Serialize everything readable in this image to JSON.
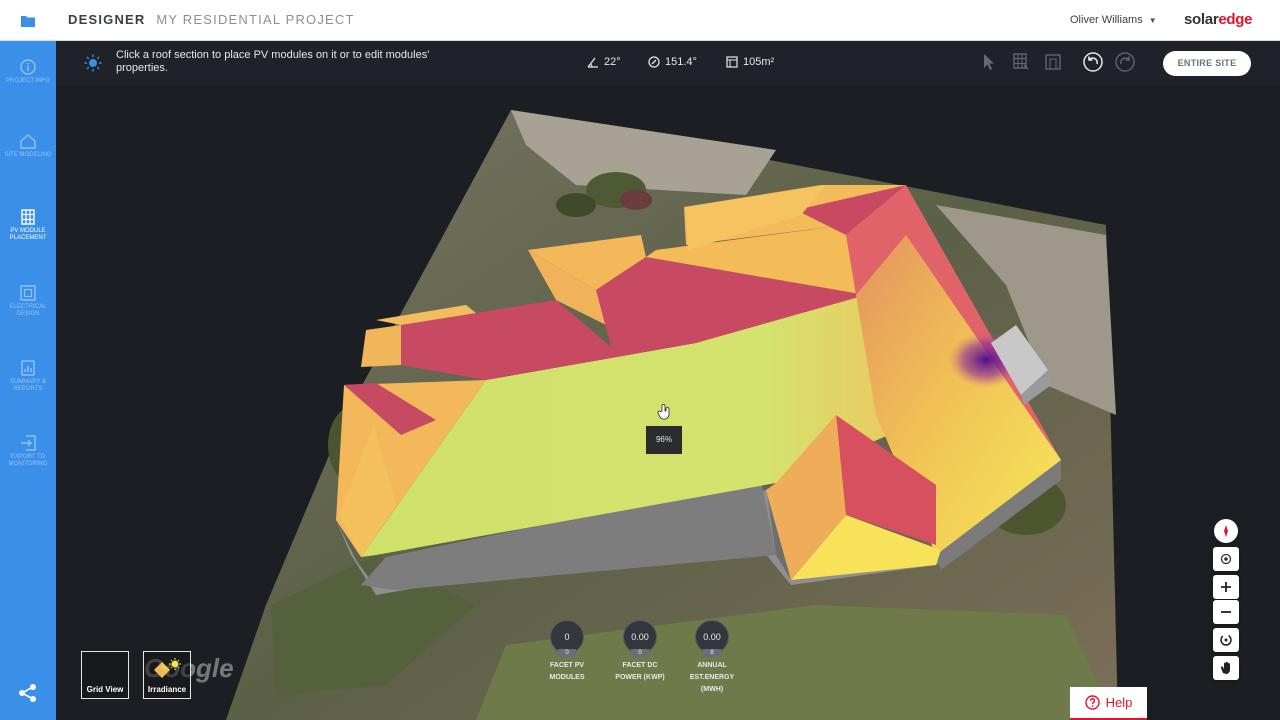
{
  "header": {
    "app_name": "DESIGNER",
    "project_name": "MY RESIDENTIAL PROJECT",
    "user_name": "Oliver Williams",
    "logo_part1": "solar",
    "logo_part2": "edge"
  },
  "sidebar": {
    "items": [
      {
        "label": "PROJECT INFO",
        "icon": "info-icon",
        "active": false
      },
      {
        "label": "SITE MODELING",
        "icon": "house-icon",
        "active": false
      },
      {
        "label": "PV MODULE PLACEMENT",
        "icon": "grid-icon",
        "active": true
      },
      {
        "label": "ELECTRICAL DESIGN",
        "icon": "electrical-icon",
        "active": false
      },
      {
        "label": "SUMMARY & REPORTS",
        "icon": "report-icon",
        "active": false
      },
      {
        "label": "EXPORT TO MONITORING",
        "icon": "export-icon",
        "active": false
      }
    ]
  },
  "toolbar": {
    "hint": "Click a roof section to place PV modules on it or to edit modules' properties.",
    "tilt": "22°",
    "azimuth": "151.4°",
    "area": "105m²",
    "entire_site_label": "ENTIRE SITE"
  },
  "map": {
    "tooltip": "96%",
    "views": [
      {
        "label": "Grid View"
      },
      {
        "label": "Irradiance"
      }
    ],
    "stats": [
      {
        "value": "0",
        "sub": "0",
        "label_lines": [
          "FACET PV",
          "MODULES"
        ]
      },
      {
        "value": "0.00",
        "sub": "0",
        "label_lines": [
          "FACET DC",
          "POWER (kWp)"
        ]
      },
      {
        "value": "0.00",
        "sub": "8",
        "label_lines": [
          "ANNUAL",
          "EST.ENERGY",
          "(MWh)"
        ]
      }
    ],
    "help_label": "Help"
  },
  "colors": {
    "brand_blue": "#3a8fe8",
    "brand_red": "#e4132b",
    "roof_high": "#d4e36e",
    "roof_mid": "#f6c457",
    "roof_low": "#c9485f"
  }
}
